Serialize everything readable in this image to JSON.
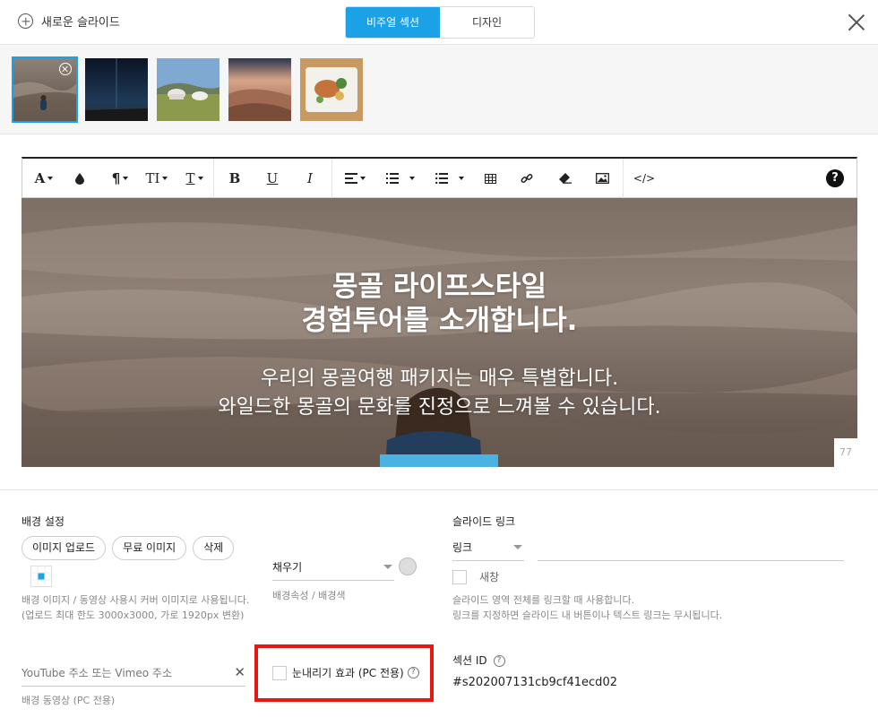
{
  "header": {
    "new_slide_label": "새로운 슬라이드",
    "tabs": [
      {
        "label": "비주얼 섹션",
        "active": true
      },
      {
        "label": "디자인",
        "active": false
      }
    ]
  },
  "thumbnails": [
    {
      "name": "desert-person",
      "selected": true
    },
    {
      "name": "night-sky",
      "selected": false
    },
    {
      "name": "yurt-field",
      "selected": false
    },
    {
      "name": "sunset-dunes",
      "selected": false
    },
    {
      "name": "food-plate",
      "selected": false
    }
  ],
  "toolbar": {
    "font_label": "A",
    "paragraph_label": "¶",
    "size_label": "TI",
    "type_label": "T",
    "bold_label": "B",
    "underline_label": "U",
    "italic_label": "I",
    "code_label": "</>",
    "help_label": "?"
  },
  "hero": {
    "title_line1": "몽골 라이프스타일",
    "title_line2": "경험투어를 소개합니다.",
    "sub_line1": "우리의 몽골여행 패키지는 매우 특별합니다.",
    "sub_line2": "와일드한 몽골의 문화를 진정으로 느껴볼 수 있습니다.",
    "page_num": "77"
  },
  "background": {
    "label": "배경 설정",
    "upload_btn": "이미지 업로드",
    "free_btn": "무료 이미지",
    "delete_btn": "삭제",
    "hint_line1": "배경 이미지 / 동영상 사용시 커버 이미지로 사용됩니다.",
    "hint_line2": "(업로드 최대 한도 3000x3000, 가로 1920px 변환)",
    "fill_select": "채우기",
    "fill_hint": "배경속성 / 배경색",
    "video_placeholder": "YouTube 주소 또는 Vimeo 주소",
    "video_hint": "배경 동영상 (PC 전용)",
    "snow_label": "눈내리기 효과 (PC 전용)",
    "snow_checked": false
  },
  "link": {
    "label": "슬라이드 링크",
    "type_select": "링크",
    "new_window_label": "새창",
    "new_window_checked": false,
    "hint_line1": "슬라이드 영역 전체를 링크할 때 사용합니다.",
    "hint_line2": "링크를 지정하면 슬라이드 내 버튼이나 텍스트 링크는 무시됩니다."
  },
  "section_id": {
    "label": "섹션 ID",
    "value": "#s202007131cb9cf41ecd02"
  }
}
